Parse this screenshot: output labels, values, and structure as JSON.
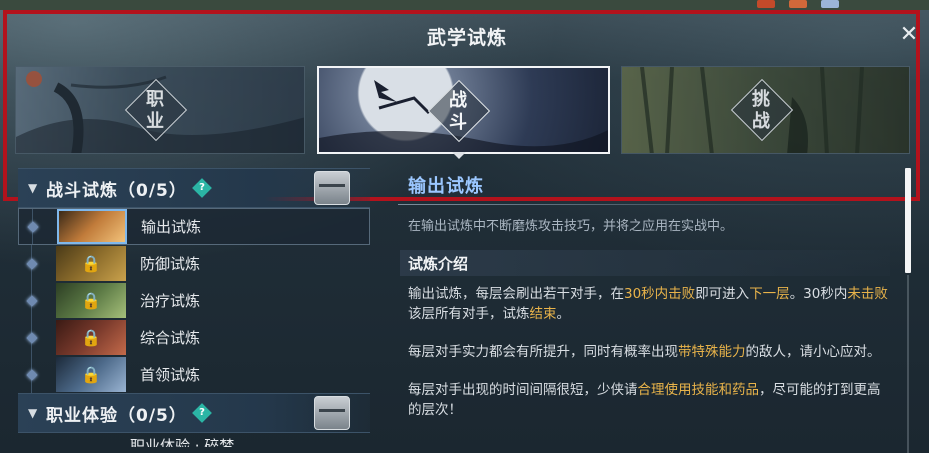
{
  "window": {
    "title": "武学试炼",
    "close_label": "✕"
  },
  "tabs": [
    {
      "label": "职业",
      "selected": false,
      "icon": "silhouette-wind-icon"
    },
    {
      "label": "战斗",
      "selected": true,
      "icon": "moon-fighter-icon"
    },
    {
      "label": "挑战",
      "selected": false,
      "icon": "bamboo-forest-icon"
    }
  ],
  "groups": [
    {
      "title": "战斗试炼（0/5）",
      "chevron": "▼",
      "help": "?",
      "items": [
        {
          "label": "输出试炼",
          "locked": false,
          "selected": true,
          "color": "#c07b3a"
        },
        {
          "label": "防御试炼",
          "locked": true,
          "selected": false,
          "color": "#8d6d2c"
        },
        {
          "label": "治疗试炼",
          "locked": true,
          "selected": false,
          "color": "#5c7a45"
        },
        {
          "label": "综合试炼",
          "locked": true,
          "selected": false,
          "color": "#7a3a2c"
        },
        {
          "label": "首领试炼",
          "locked": true,
          "selected": false,
          "color": "#4d6a8a"
        }
      ]
    },
    {
      "title": "职业体验（0/5）",
      "chevron": "▼",
      "help": "?",
      "items": [
        {
          "label": "职业体验 · 碎梦",
          "partial": true
        }
      ]
    }
  ],
  "detail": {
    "title": "输出试炼",
    "subtitle": "在输出试炼中不断磨炼攻击技巧，并将之应用在实战中。",
    "section_title": "试炼介绍",
    "paragraphs": [
      [
        {
          "t": "输出试炼，每层会刷出若干对手，在"
        },
        {
          "t": "30秒内击败",
          "hl": true
        },
        {
          "t": "即可进入"
        },
        {
          "t": "下一层",
          "hl": true
        },
        {
          "t": "。30秒内"
        },
        {
          "t": "未击败",
          "hl": true
        },
        {
          "t": "该层所有对手，试炼"
        },
        {
          "t": "结束",
          "hl": true
        },
        {
          "t": "。"
        }
      ],
      [
        {
          "t": "每层对手实力都会有所提升，同时有概率出现"
        },
        {
          "t": "带特殊能力",
          "hl": true
        },
        {
          "t": "的敌人，请小心应对。"
        }
      ],
      [
        {
          "t": "每层对手出现的时间间隔很短，少侠请"
        },
        {
          "t": "合理使用技能和药品",
          "hl": true
        },
        {
          "t": "，尽可能的打到更高的层次！"
        }
      ]
    ]
  },
  "colors": {
    "highlight": "#e8b34a",
    "title_blue": "#9bc7ff",
    "frame_red": "#b3121c"
  }
}
